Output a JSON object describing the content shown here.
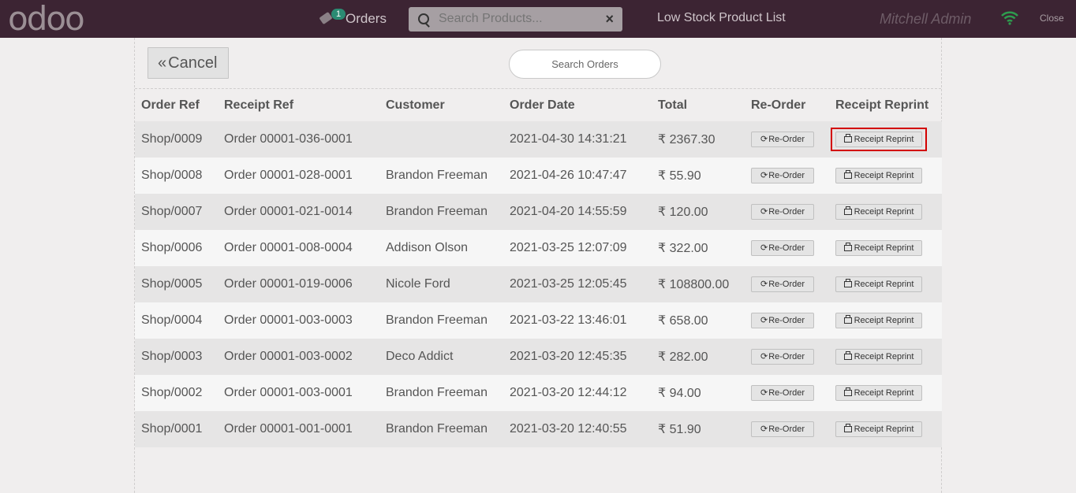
{
  "header": {
    "logo_text": "odoo",
    "orders_label": "Orders",
    "orders_count": "1",
    "search_placeholder": "Search Products...",
    "low_stock_label": "Low Stock Product List",
    "user_name": "Mitchell Admin",
    "close_label": "Close",
    "icons": [
      "tag-icon",
      "search-icon",
      "clear-icon",
      "wifi-icon"
    ]
  },
  "toolbar": {
    "cancel_label": "Cancel",
    "search_orders_placeholder": "Search Orders"
  },
  "table": {
    "columns": [
      "Order Ref",
      "Receipt Ref",
      "Customer",
      "Order Date",
      "Total",
      "Re-Order",
      "Receipt Reprint"
    ],
    "reorder_label": "Re-Order",
    "reprint_label": "Receipt Reprint",
    "currency_symbol": "₹",
    "rows": [
      {
        "order_ref": "Shop/0009",
        "receipt_ref": "Order 00001-036-0001",
        "customer": "",
        "order_date": "2021-04-30 14:31:21",
        "total": "2367.30",
        "highlighted": true
      },
      {
        "order_ref": "Shop/0008",
        "receipt_ref": "Order 00001-028-0001",
        "customer": "Brandon Freeman",
        "order_date": "2021-04-26 10:47:47",
        "total": "55.90",
        "highlighted": false
      },
      {
        "order_ref": "Shop/0007",
        "receipt_ref": "Order 00001-021-0014",
        "customer": "Brandon Freeman",
        "order_date": "2021-04-20 14:55:59",
        "total": "120.00",
        "highlighted": false
      },
      {
        "order_ref": "Shop/0006",
        "receipt_ref": "Order 00001-008-0004",
        "customer": "Addison Olson",
        "order_date": "2021-03-25 12:07:09",
        "total": "322.00",
        "highlighted": false
      },
      {
        "order_ref": "Shop/0005",
        "receipt_ref": "Order 00001-019-0006",
        "customer": "Nicole Ford",
        "order_date": "2021-03-25 12:05:45",
        "total": "108800.00",
        "highlighted": false
      },
      {
        "order_ref": "Shop/0004",
        "receipt_ref": "Order 00001-003-0003",
        "customer": "Brandon Freeman",
        "order_date": "2021-03-22 13:46:01",
        "total": "658.00",
        "highlighted": false
      },
      {
        "order_ref": "Shop/0003",
        "receipt_ref": "Order 00001-003-0002",
        "customer": "Deco Addict",
        "order_date": "2021-03-20 12:45:35",
        "total": "282.00",
        "highlighted": false
      },
      {
        "order_ref": "Shop/0002",
        "receipt_ref": "Order 00001-003-0001",
        "customer": "Brandon Freeman",
        "order_date": "2021-03-20 12:44:12",
        "total": "94.00",
        "highlighted": false
      },
      {
        "order_ref": "Shop/0001",
        "receipt_ref": "Order 00001-001-0001",
        "customer": "Brandon Freeman",
        "order_date": "2021-03-20 12:40:55",
        "total": "51.90",
        "highlighted": false
      }
    ]
  },
  "colors": {
    "topbar": "#3c2433",
    "badge": "#2b8b73",
    "highlight": "#d30000"
  }
}
